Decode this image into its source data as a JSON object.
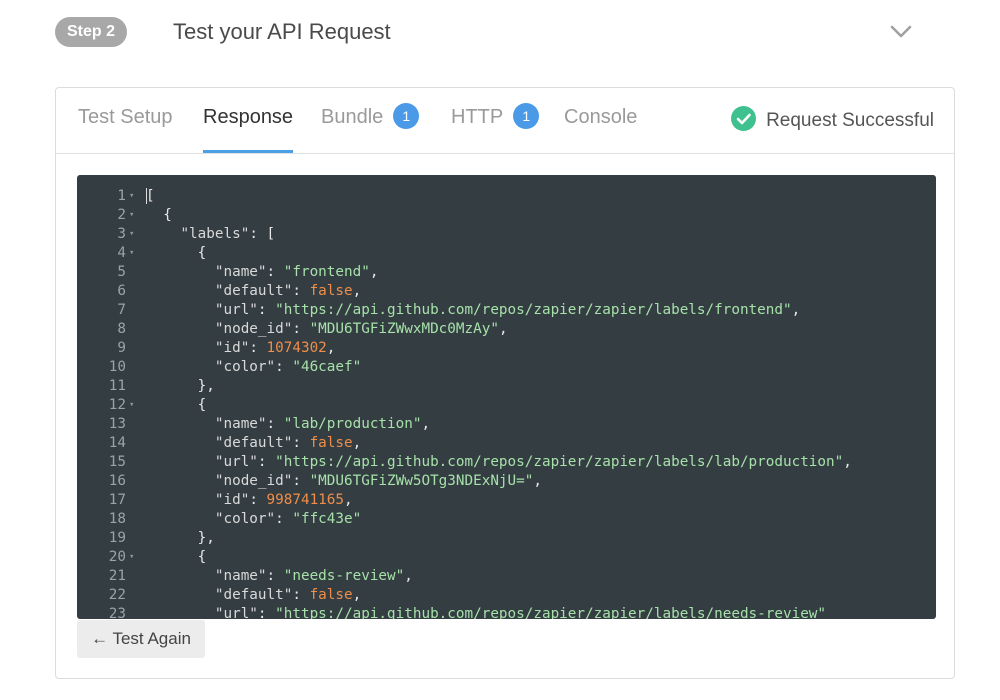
{
  "step": {
    "badge": "Step 2",
    "title": "Test your API Request",
    "chevron_icon": "chevron-down-icon"
  },
  "tabs": [
    {
      "label": "Test Setup",
      "active": false
    },
    {
      "label": "Response",
      "active": true
    },
    {
      "label": "Bundle",
      "badge": "1",
      "active": false
    },
    {
      "label": "HTTP",
      "badge": "1",
      "active": false
    },
    {
      "label": "Console",
      "active": false
    }
  ],
  "status": {
    "icon": "check-circle-icon",
    "text": "Request Successful",
    "color": "#3fc18f"
  },
  "colors": {
    "accent": "#4b9fe5",
    "badge": "#4b9ae8",
    "editor_bg": "#343d42",
    "string": "#a6e1a9",
    "number": "#f08d49"
  },
  "code": {
    "lines": [
      {
        "num": "1",
        "fold": true,
        "text": "["
      },
      {
        "num": "2",
        "fold": true,
        "text": "  {"
      },
      {
        "num": "3",
        "fold": true,
        "text": "    \"labels\": ["
      },
      {
        "num": "4",
        "fold": true,
        "text": "      {"
      },
      {
        "num": "5",
        "fold": false,
        "text": "        \"name\": \"frontend\","
      },
      {
        "num": "6",
        "fold": false,
        "text": "        \"default\": false,"
      },
      {
        "num": "7",
        "fold": false,
        "text": "        \"url\": \"https://api.github.com/repos/zapier/zapier/labels/frontend\","
      },
      {
        "num": "8",
        "fold": false,
        "text": "        \"node_id\": \"MDU6TGFiZWwxMDc0MzAy\","
      },
      {
        "num": "9",
        "fold": false,
        "text": "        \"id\": 1074302,"
      },
      {
        "num": "10",
        "fold": false,
        "text": "        \"color\": \"46caef\""
      },
      {
        "num": "11",
        "fold": false,
        "text": "      },"
      },
      {
        "num": "12",
        "fold": true,
        "text": "      {"
      },
      {
        "num": "13",
        "fold": false,
        "text": "        \"name\": \"lab/production\","
      },
      {
        "num": "14",
        "fold": false,
        "text": "        \"default\": false,"
      },
      {
        "num": "15",
        "fold": false,
        "text": "        \"url\": \"https://api.github.com/repos/zapier/zapier/labels/lab/production\","
      },
      {
        "num": "16",
        "fold": false,
        "text": "        \"node_id\": \"MDU6TGFiZWw5OTg3NDExNjU=\","
      },
      {
        "num": "17",
        "fold": false,
        "text": "        \"id\": 998741165,"
      },
      {
        "num": "18",
        "fold": false,
        "text": "        \"color\": \"ffc43e\""
      },
      {
        "num": "19",
        "fold": false,
        "text": "      },"
      },
      {
        "num": "20",
        "fold": true,
        "text": "      {"
      },
      {
        "num": "21",
        "fold": false,
        "text": "        \"name\": \"needs-review\","
      },
      {
        "num": "22",
        "fold": false,
        "text": "        \"default\": false,"
      },
      {
        "num": "23",
        "fold": false,
        "text": "        \"url\": \"https://api.github.com/repos/zapier/zapier/labels/needs-review\""
      }
    ]
  },
  "actions": {
    "test_again": "← Test Again"
  }
}
